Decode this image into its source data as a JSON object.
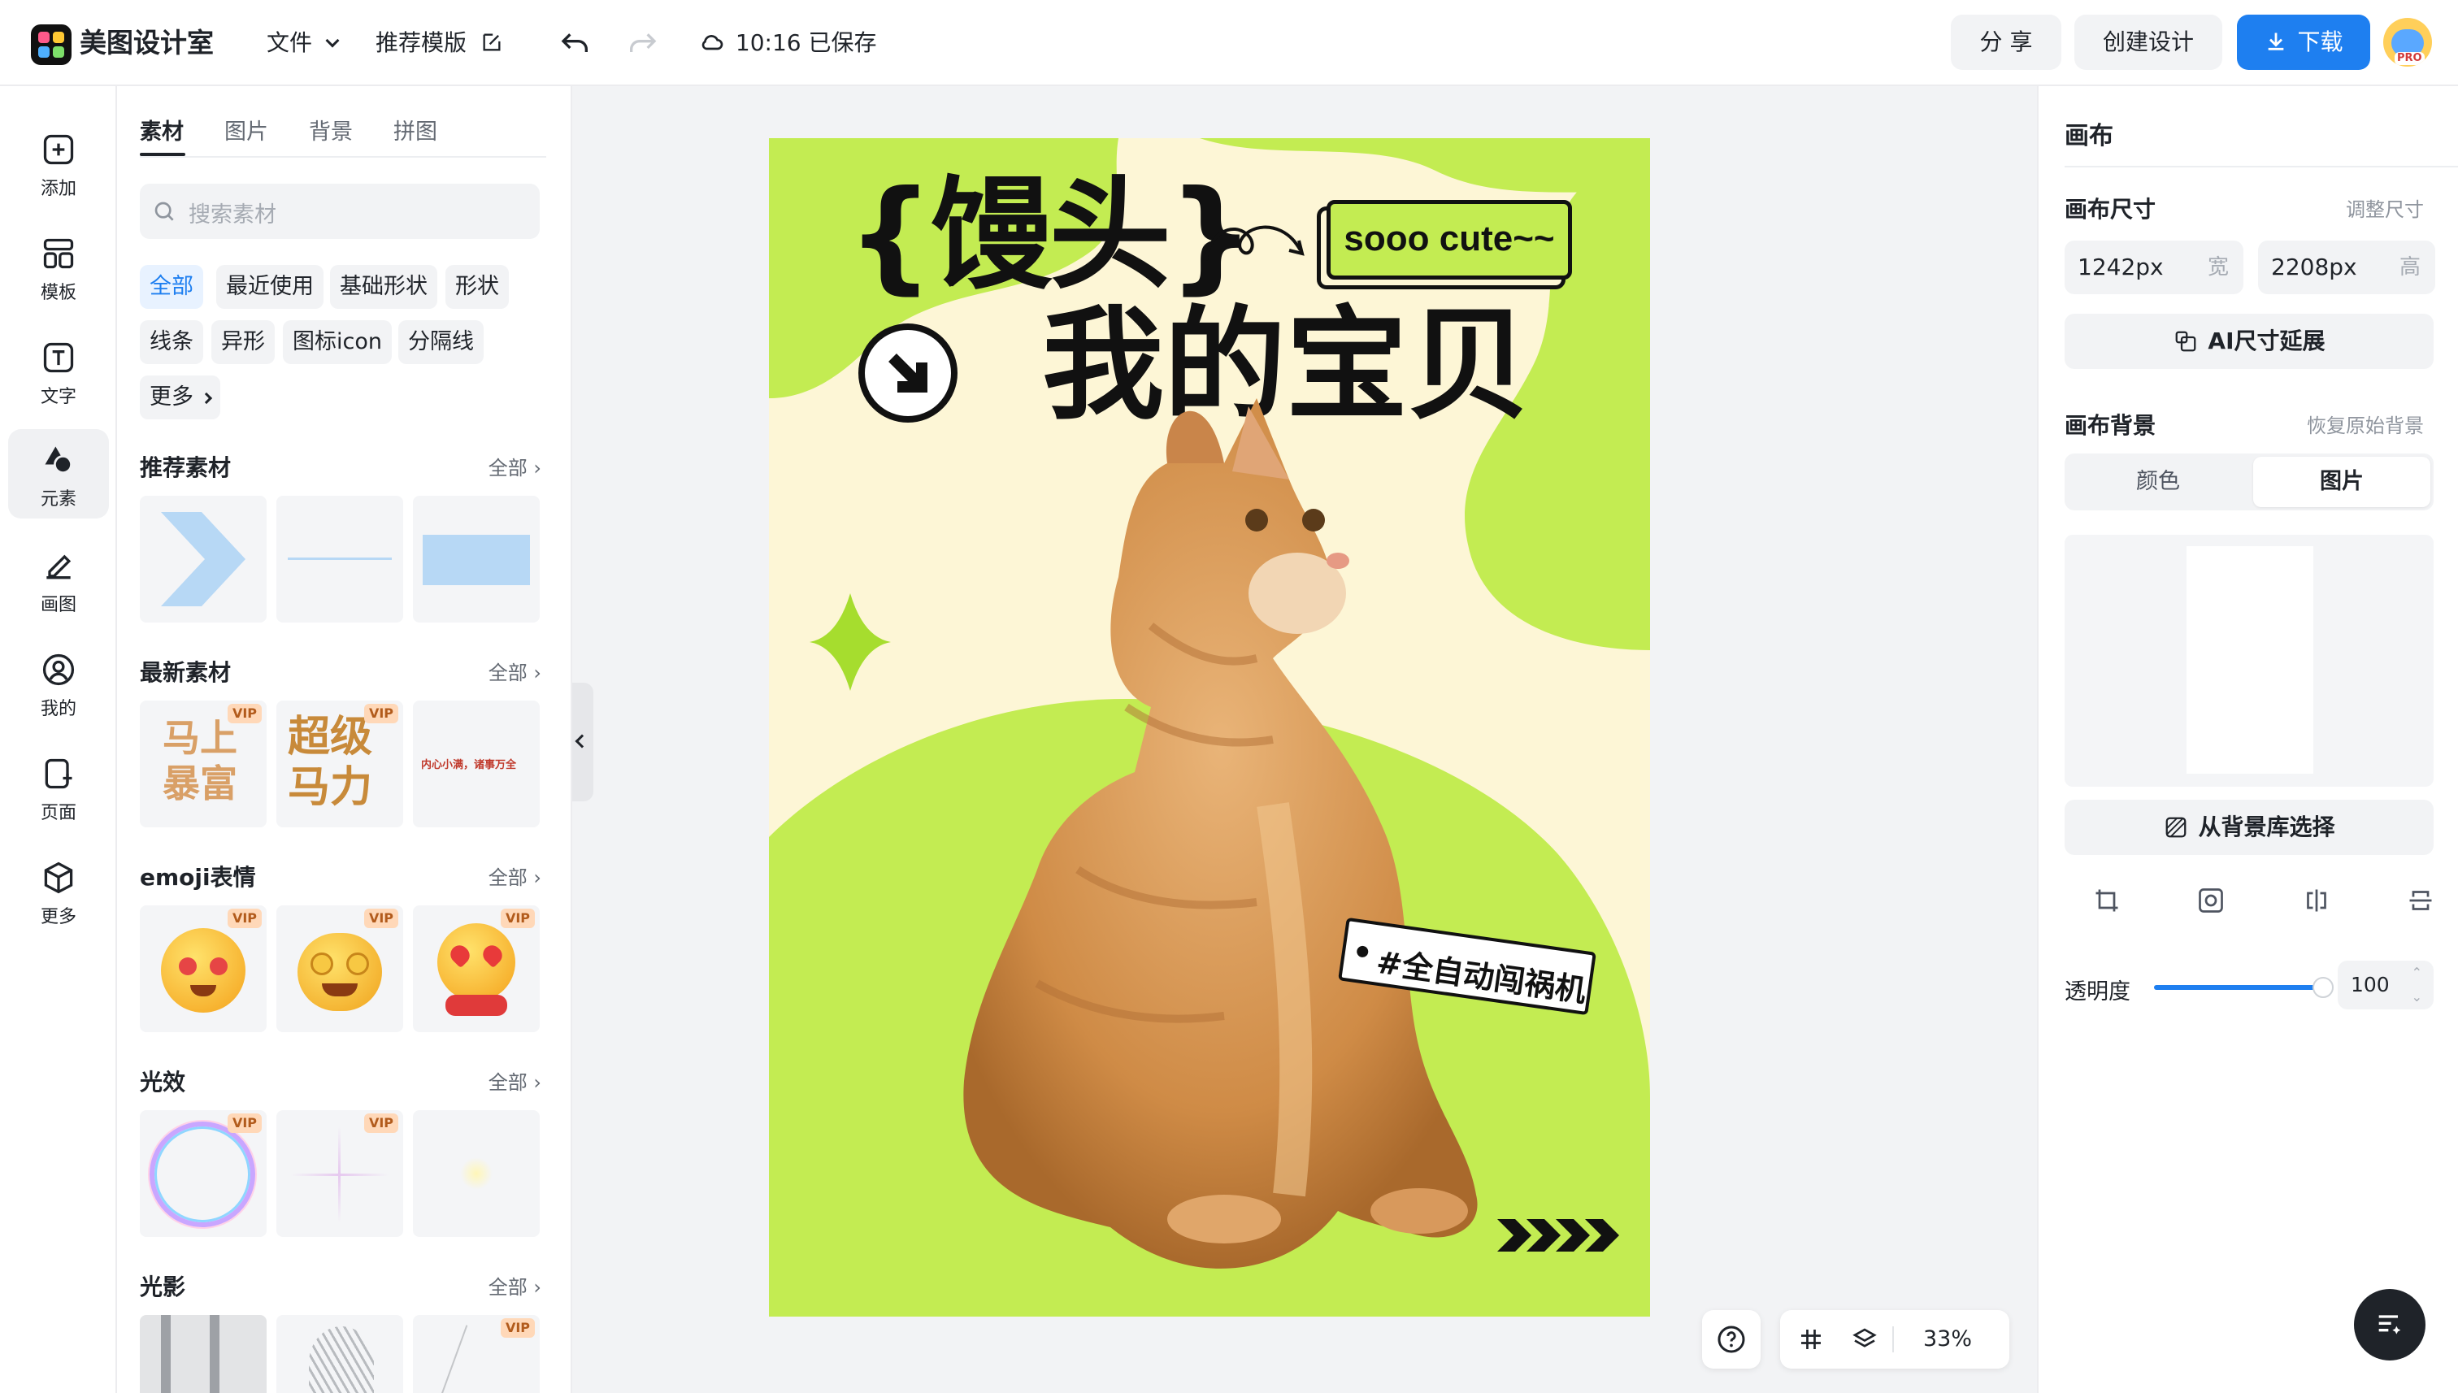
{
  "topbar": {
    "app_name": "美图设计室",
    "menu_file": "文件",
    "menu_templates": "推荐模版",
    "save_status": "10:16 已保存",
    "share_label": "分 享",
    "create_label": "创建设计",
    "download_label": "下载",
    "pro_badge": "PRO",
    "accent_color": "#1e7ff0"
  },
  "rail": {
    "items": [
      {
        "label": "添加",
        "icon": "plus-square-icon"
      },
      {
        "label": "模板",
        "icon": "template-icon"
      },
      {
        "label": "文字",
        "icon": "text-icon"
      },
      {
        "label": "元素",
        "icon": "shapes-icon"
      },
      {
        "label": "画图",
        "icon": "draw-icon"
      },
      {
        "label": "我的",
        "icon": "user-icon"
      },
      {
        "label": "页面",
        "icon": "page-icon"
      },
      {
        "label": "更多",
        "icon": "cube-icon"
      }
    ],
    "active_index": 3
  },
  "panel": {
    "tabs": [
      "素材",
      "图片",
      "背景",
      "拼图"
    ],
    "active_tab": 0,
    "search_placeholder": "搜索素材",
    "chips": [
      "全部",
      "最近使用",
      "基础形状",
      "形状",
      "线条",
      "异形",
      "图标icon",
      "分隔线",
      "更多"
    ],
    "sections": [
      {
        "title": "推荐素材",
        "all": "全部"
      },
      {
        "title": "最新素材",
        "all": "全部"
      },
      {
        "title": "emoji表情",
        "all": "全部"
      },
      {
        "title": "光效",
        "all": "全部"
      },
      {
        "title": "光影",
        "all": "全部"
      }
    ],
    "vip_label": "VIP",
    "sticker_texts": {
      "mashang": "马上\n暴富",
      "chaoji": "超级\n马力",
      "small_tile": "内心小满，诸事万全"
    }
  },
  "canvas": {
    "bg_color": "#fdf6d6",
    "green_color": "#c3ec52",
    "title_line1": "{馒头}",
    "title_line2": "我的宝贝",
    "tag_cute": "sooo cute~~",
    "tag_auto": "#全自动闯祸机"
  },
  "zoom": {
    "value": "33%"
  },
  "rpanel": {
    "header": "画布",
    "size_label": "画布尺寸",
    "size_adjust": "调整尺寸",
    "width_value": "1242px",
    "width_unit": "宽",
    "height_value": "2208px",
    "height_unit": "高",
    "ai_extend": "AI尺寸延展",
    "bg_label": "画布背景",
    "bg_restore": "恢复原始背景",
    "bg_tabs": [
      "颜色",
      "图片"
    ],
    "bg_active_tab": 1,
    "bg_library": "从背景库选择",
    "opacity_label": "透明度",
    "opacity_value": "100",
    "opacity_fraction": 1.0
  }
}
